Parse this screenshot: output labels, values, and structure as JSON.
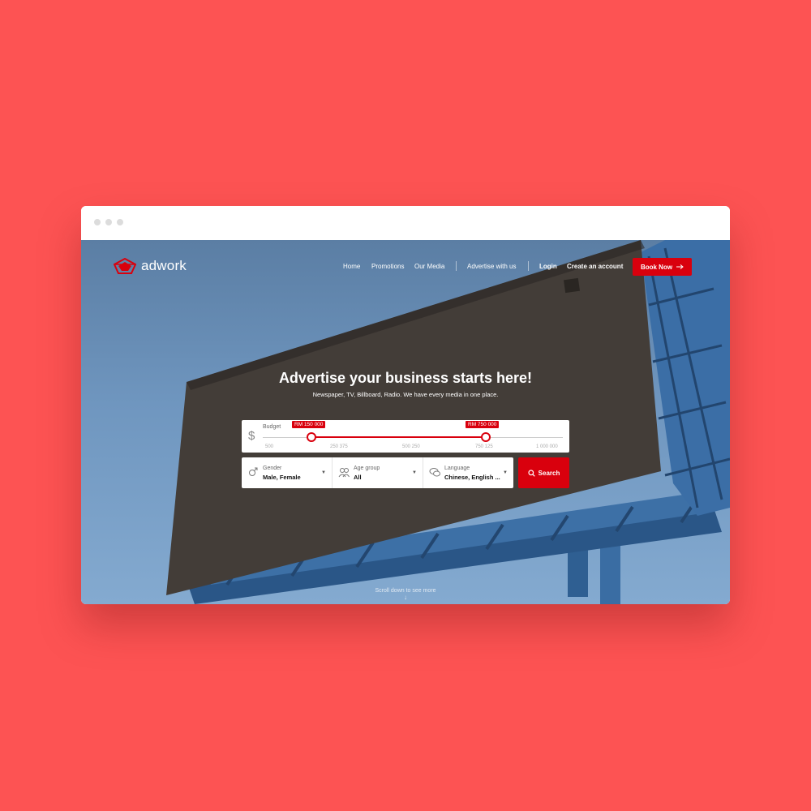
{
  "brand": {
    "name": "adwork",
    "accent": "#d9000d",
    "page_bg": "#fd5353"
  },
  "window": {
    "controls": [
      "close-dot",
      "minimize-dot",
      "maximize-dot"
    ]
  },
  "nav": {
    "links": [
      "Home",
      "Promotions",
      "Our Media",
      "Advertise with us"
    ],
    "login": "Login",
    "create_account": "Create an account",
    "book_now": "Book Now"
  },
  "hero": {
    "headline": "Advertise your business starts here!",
    "subline": "Newspaper, TV, Billboard, Radio. We have every media in one place.",
    "scroll_hint": "Scroll down to see more"
  },
  "budget": {
    "label": "Budget",
    "currency_symbol": "$",
    "min_label": "RM 150 000",
    "max_label": "RM 750 000",
    "ticks": [
      "500",
      "250 375",
      "500 250",
      "750 125",
      "1 000 000"
    ],
    "selected_min": 150000,
    "selected_max": 750000
  },
  "filters": {
    "gender": {
      "label": "Gender",
      "value": "Male, Female",
      "icon": "gender-icon"
    },
    "age": {
      "label": "Age group",
      "value": "All",
      "icon": "people-icon"
    },
    "language": {
      "label": "Language",
      "value": "Chinese, English ...",
      "icon": "speech-bubbles-icon"
    }
  },
  "search": {
    "label": "Search",
    "icon": "search-icon"
  }
}
